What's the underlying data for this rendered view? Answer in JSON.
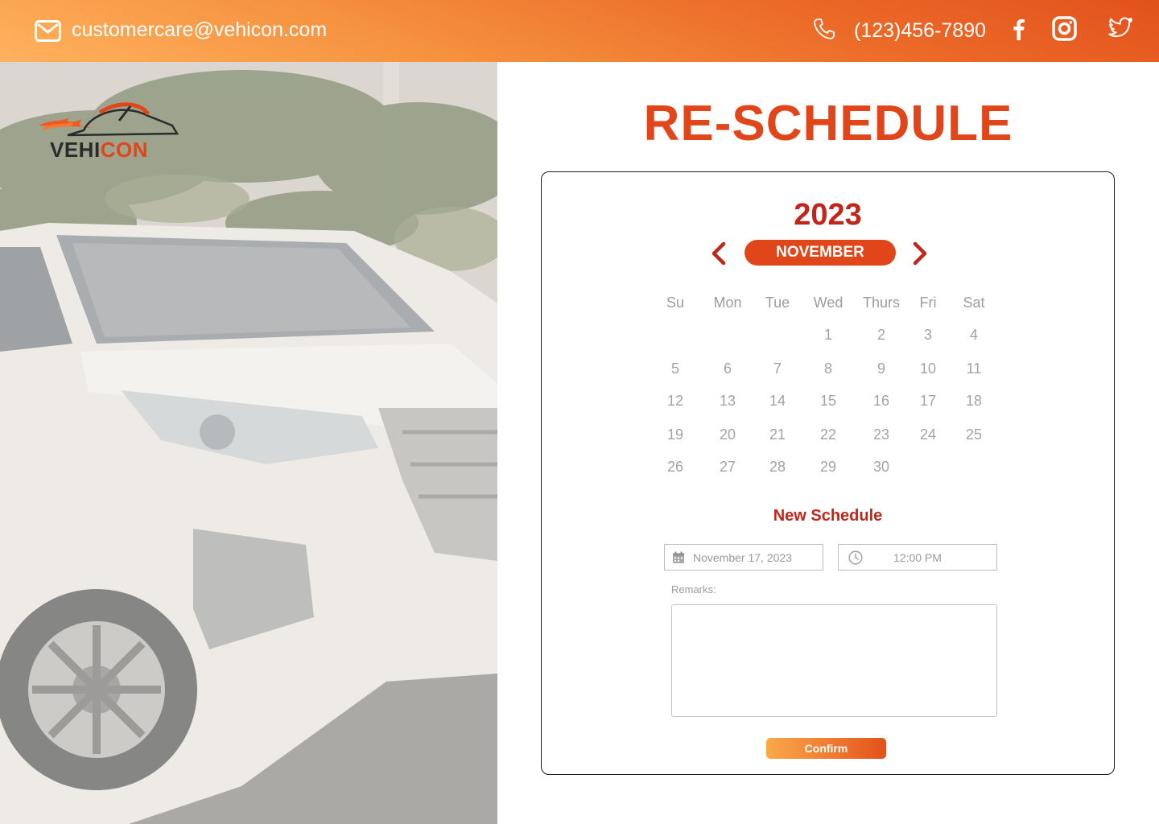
{
  "topbar": {
    "email": "customercare@vehicon.com",
    "phone": "(123)456-7890",
    "icons": [
      "mail-icon",
      "phone-icon",
      "facebook-icon",
      "instagram-icon",
      "twitter-icon"
    ]
  },
  "brand": {
    "name_part1": "VEHI",
    "name_part2": "CON",
    "accent_color": "#e0461a"
  },
  "page": {
    "title": "RE-SCHEDULE"
  },
  "calendar": {
    "year": "2023",
    "month": "NOVEMBER",
    "weekdays": [
      "Su",
      "Mon",
      "Tue",
      "Wed",
      "Thurs",
      "Fri",
      "Sat"
    ],
    "weeks": [
      [
        "",
        "",
        "",
        "1",
        "2",
        "3",
        "4"
      ],
      [
        "5",
        "6",
        "7",
        "8",
        "9",
        "10",
        "11"
      ],
      [
        "12",
        "13",
        "14",
        "15",
        "16",
        "17",
        "18"
      ],
      [
        "19",
        "20",
        "21",
        "22",
        "23",
        "24",
        "25"
      ],
      [
        "26",
        "27",
        "28",
        "29",
        "30",
        "",
        ""
      ]
    ]
  },
  "form": {
    "heading": "New Schedule",
    "date_value": "November 17, 2023",
    "time_value": "12:00 PM",
    "remarks_label": "Remarks:",
    "remarks_value": "",
    "confirm_label": "Confirm"
  }
}
